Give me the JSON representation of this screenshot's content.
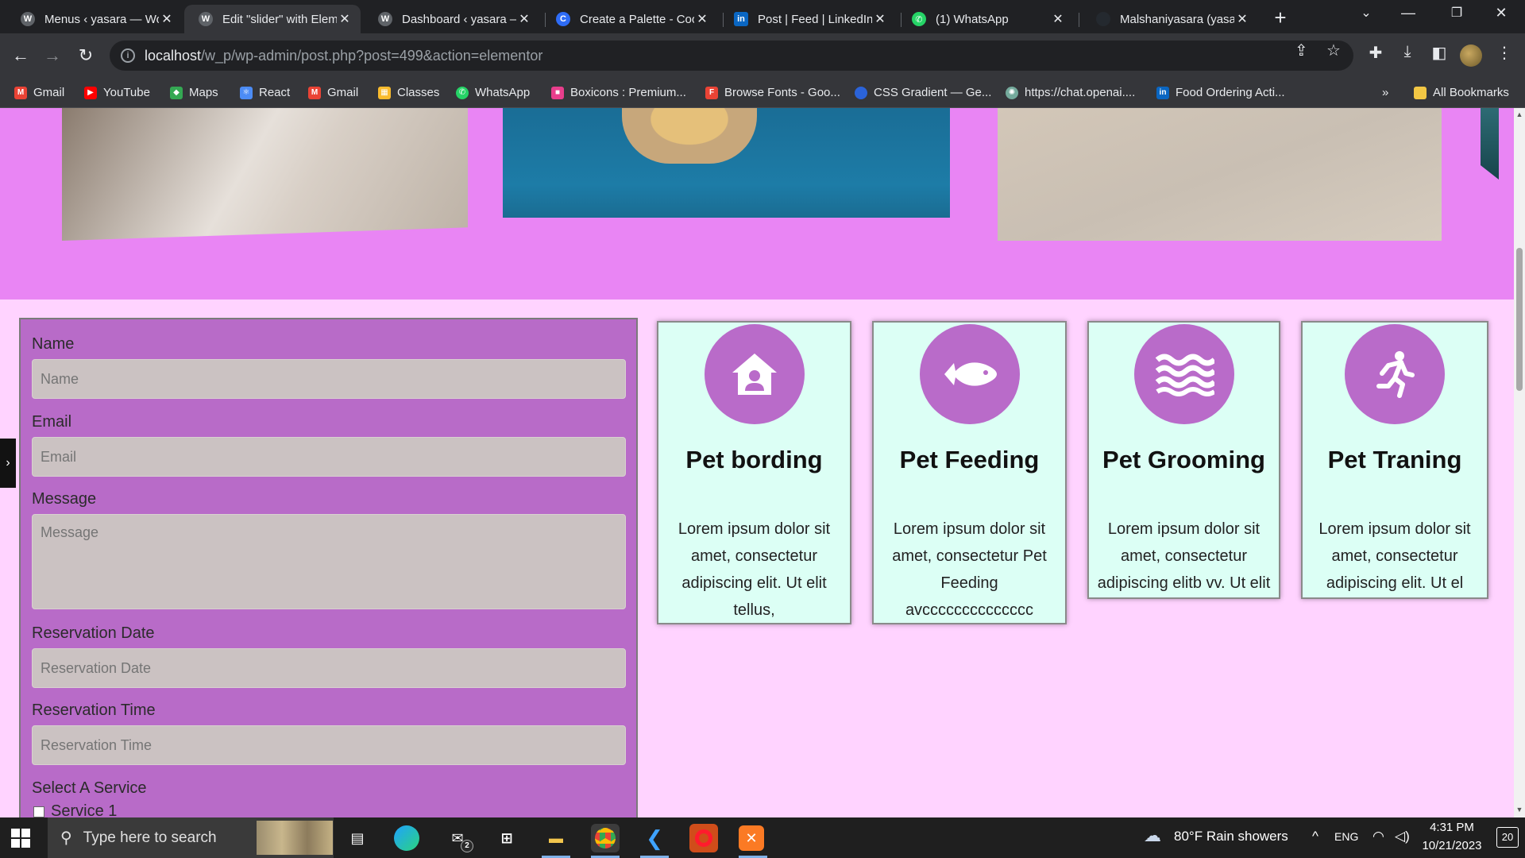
{
  "browser": {
    "tabs": [
      {
        "title": "Menus ‹ yasara — WordPress",
        "favicon": "wordpress",
        "active": false
      },
      {
        "title": "Edit \"slider\" with Elementor",
        "favicon": "wordpress",
        "active": true
      },
      {
        "title": "Dashboard ‹ yasara — WordPress",
        "favicon": "wordpress",
        "active": false
      },
      {
        "title": "Create a Palette - Coolors",
        "favicon": "coolors",
        "active": false
      },
      {
        "title": "Post | Feed | LinkedIn",
        "favicon": "linkedin",
        "active": false
      },
      {
        "title": "(1) WhatsApp",
        "favicon": "whatsapp",
        "active": false
      },
      {
        "title": "Malshaniyasara (yasara)",
        "favicon": "github",
        "active": false
      }
    ],
    "address": {
      "host": "localhost",
      "path": "/w_p/wp-admin/post.php?post=499&action=elementor"
    },
    "bookmarks": [
      {
        "label": "Gmail",
        "icon": "gmail-icon",
        "color": "#ea4335"
      },
      {
        "label": "YouTube",
        "icon": "youtube-icon",
        "color": "#ff0000"
      },
      {
        "label": "Maps",
        "icon": "maps-icon",
        "color": "#34a853"
      },
      {
        "label": "React",
        "icon": "react-icon",
        "color": "#4c8cf5"
      },
      {
        "label": "Gmail",
        "icon": "gmail-icon",
        "color": "#ea4335"
      },
      {
        "label": "Classes",
        "icon": "classroom-icon",
        "color": "#f9bb2d"
      },
      {
        "label": "WhatsApp",
        "icon": "whatsapp-icon",
        "color": "#25d366"
      },
      {
        "label": "Boxicons : Premium...",
        "icon": "boxicons-icon",
        "color": "#e83e8c"
      },
      {
        "label": "Browse Fonts - Goo...",
        "icon": "google-fonts-icon",
        "color": "#ea4335"
      },
      {
        "label": "CSS Gradient — Ge...",
        "icon": "css-gradient-icon",
        "color": "#2b63d9"
      },
      {
        "label": "https://chat.openai....",
        "icon": "openai-icon",
        "color": "#74aa9c"
      },
      {
        "label": "Food Ordering Acti...",
        "icon": "linkedin-icon",
        "color": "#0a66c2"
      }
    ],
    "all_bookmarks": "All Bookmarks",
    "overflow": "»"
  },
  "form": {
    "fields": [
      {
        "label": "Name",
        "placeholder": "Name"
      },
      {
        "label": "Email",
        "placeholder": "Email"
      },
      {
        "label": "Message",
        "placeholder": "Message"
      },
      {
        "label": "Reservation Date",
        "placeholder": "Reservation Date"
      },
      {
        "label": "Reservation Time",
        "placeholder": "Reservation Time"
      }
    ],
    "service_label": "Select A Service",
    "service_option": "Service 1"
  },
  "services": [
    {
      "title": "Pet bording",
      "text": "Lorem ipsum dolor sit amet, consectetur adipiscing elit. Ut elit tellus,",
      "icon": "house-user-icon"
    },
    {
      "title": "Pet Feeding",
      "text": "Lorem ipsum dolor sit amet, consectetur Pet Feeding avcccccccccccccc",
      "icon": "fish-icon"
    },
    {
      "title": "Pet Grooming",
      "text": "Lorem ipsum dolor sit amet, consectetur adipiscing elitb vv. Ut elit",
      "icon": "water-waves-icon"
    },
    {
      "title": "Pet Traning",
      "text": "Lorem ipsum dolor sit amet, consectetur adipiscing elit. Ut el",
      "icon": "running-icon"
    }
  ],
  "taskbar": {
    "search_placeholder": "Type here to search",
    "mail_badge": "2",
    "weather": "80°F  Rain showers",
    "time": "4:31 PM",
    "date": "10/21/2023",
    "notification_count": "20"
  },
  "colors": {
    "slider_band": "#e985f4",
    "page_bg": "#ffd3ff",
    "form_bg": "#b86bc8",
    "card_bg": "#dcfff5",
    "icon_circle": "#b96bc9"
  }
}
